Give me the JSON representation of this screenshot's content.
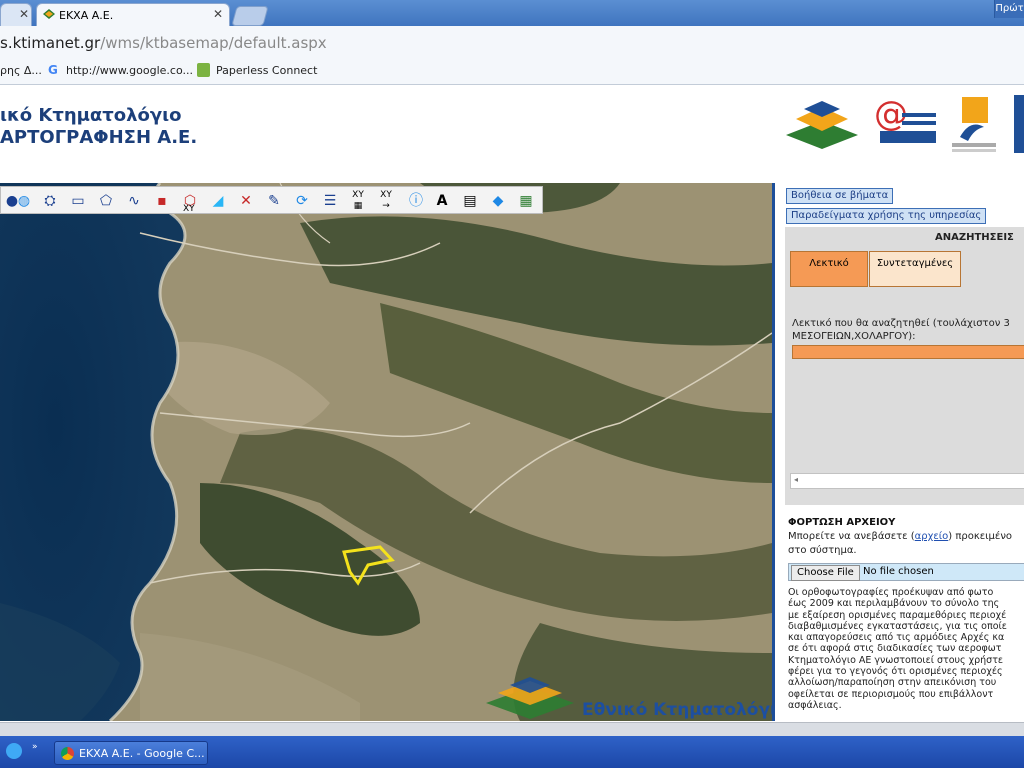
{
  "browser": {
    "tabs": [
      {
        "label": ""
      },
      {
        "label": "ΕΚΧΑ Α.Ε."
      }
    ],
    "window_label": "Πρώτ",
    "address": {
      "host": "s.ktimanet.gr",
      "path": "/wms/ktbasemap/default.aspx"
    },
    "bookmarks": [
      {
        "label": "ρης Δ..."
      },
      {
        "label": "http://www.google.co..."
      },
      {
        "label": "Paperless Connect"
      }
    ]
  },
  "header": {
    "title_line1": "ικό Κτηματολόγιο",
    "title_line2": "ΑΡΤΟΓΡΑΦΗΣΗ Α.Ε."
  },
  "map": {
    "watermark": "Εθνικό Κτηματολόγιο",
    "tools": [
      "globe-tool",
      "layers-tool",
      "polyline-tool",
      "polygon-tool",
      "line-tool",
      "point-tool",
      "area-xy-tool",
      "add-point-tool",
      "delete-tool",
      "edit-tool",
      "refresh-tool",
      "list-tool",
      "xy-table-tool",
      "xy-goto-tool",
      "info-tool",
      "label-tool",
      "text-tool",
      "zoom-extent-tool",
      "legend-tool"
    ],
    "tool_labels": {
      "xy": "XY"
    }
  },
  "panel": {
    "help_button": "Βοήθεια σε βήματα",
    "examples_button": "Παραδείγματα χρήσης της υπηρεσίας",
    "search": {
      "heading": "ΑΝΑΖΗΤΗΣΕΙΣ",
      "tab_text": "Λεκτικό",
      "tab_coords": "Συντεταγμένες",
      "prompt_line1": "Λεκτικό που θα αναζητηθεί (τουλάχιστον 3",
      "prompt_line2": "ΜΕΣΟΓΕΙΩΝ,ΧΟΛΑΡΓΟΥ):",
      "input_value": ""
    },
    "upload": {
      "heading": "ΦΟΡΤΩΣΗ ΑΡΧΕΙΟΥ",
      "text_before": "Μπορείτε να ανεβάσετε (",
      "link": "αρχείο",
      "text_after": ") προκειμένο",
      "text_line2": "στο σύστημα.",
      "choose_button": "Choose File",
      "no_file": "No file chosen"
    },
    "disclaimer": [
      "Οι ορθοφωτογραφίες προέκυψαν από φωτο",
      "έως 2009 και περιλαμβάνουν το σύνολο της",
      "με εξαίρεση ορισμένες παραμεθόριες περιοχέ",
      "διαβαθμισμένες εγκαταστάσεις, για τις οποίε",
      "και απαγορεύσεις από τις αρμόδιες Αρχές κα",
      "σε ότι αφορά στις διαδικασίες των αεροφωτ",
      "Κτηματολόγιο ΑΕ γνωστοποιεί στους χρήστε",
      "φέρει για το γεγονός ότι ορισμένες περιοχές",
      "αλλοίωση/παραποίηση στην απεικόνιση του",
      "οφείλεται σε περιορισμούς που επιβάλλοντ",
      "ασφάλειας."
    ]
  },
  "taskbar": {
    "window_button": "ΕΚΧΑ Α.Ε. - Google C..."
  }
}
